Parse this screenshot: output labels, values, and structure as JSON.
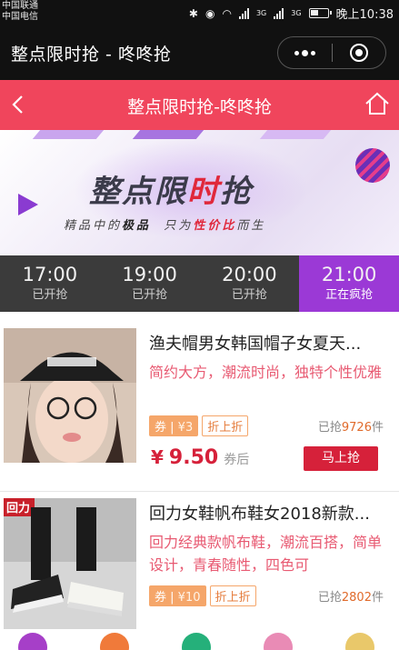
{
  "status": {
    "carrier1": "中国联通",
    "carrier2": "中国电信",
    "net1": "3G",
    "net2": "3G",
    "time": "晚上10:38"
  },
  "wechat": {
    "title": "整点限时抢 - 咚咚抢"
  },
  "header": {
    "title": "整点限时抢-咚咚抢"
  },
  "banner": {
    "title_a": "整点限",
    "title_b": "时",
    "title_c": "抢",
    "sub_a": "精品中的",
    "sub_b": "极品",
    "sub_c": "只为",
    "sub_d": "性价比",
    "sub_e": "而生"
  },
  "tabs": [
    {
      "time": "17:00",
      "status": "已开抢"
    },
    {
      "time": "19:00",
      "status": "已开抢"
    },
    {
      "time": "20:00",
      "status": "已开抢"
    },
    {
      "time": "21:00",
      "status": "正在疯抢"
    }
  ],
  "products": [
    {
      "name": "渔夫帽男女韩国帽子女夏天...",
      "desc": "简约大方，潮流时尚，独特个性优雅",
      "coupon_label": "券",
      "coupon_value": "¥3",
      "zhe": "折上折",
      "sold_prefix": "已抢",
      "sold_num": "9726",
      "sold_suffix": "件",
      "yen": "¥",
      "price": "9.50",
      "price_suffix": "券后",
      "buy": "马上抢"
    },
    {
      "name": "回力女鞋帆布鞋女2018新款...",
      "desc": "回力经典款帆布鞋，潮流百搭，简单设计，青春随性，四色可",
      "coupon_label": "券",
      "coupon_value": "¥10",
      "zhe": "折上折",
      "sold_prefix": "已抢",
      "sold_num": "2802",
      "sold_suffix": "件"
    }
  ],
  "colors": {
    "header_red": "#f0455c",
    "active_tab": "#9b39d6",
    "price_red": "#d6213a"
  }
}
